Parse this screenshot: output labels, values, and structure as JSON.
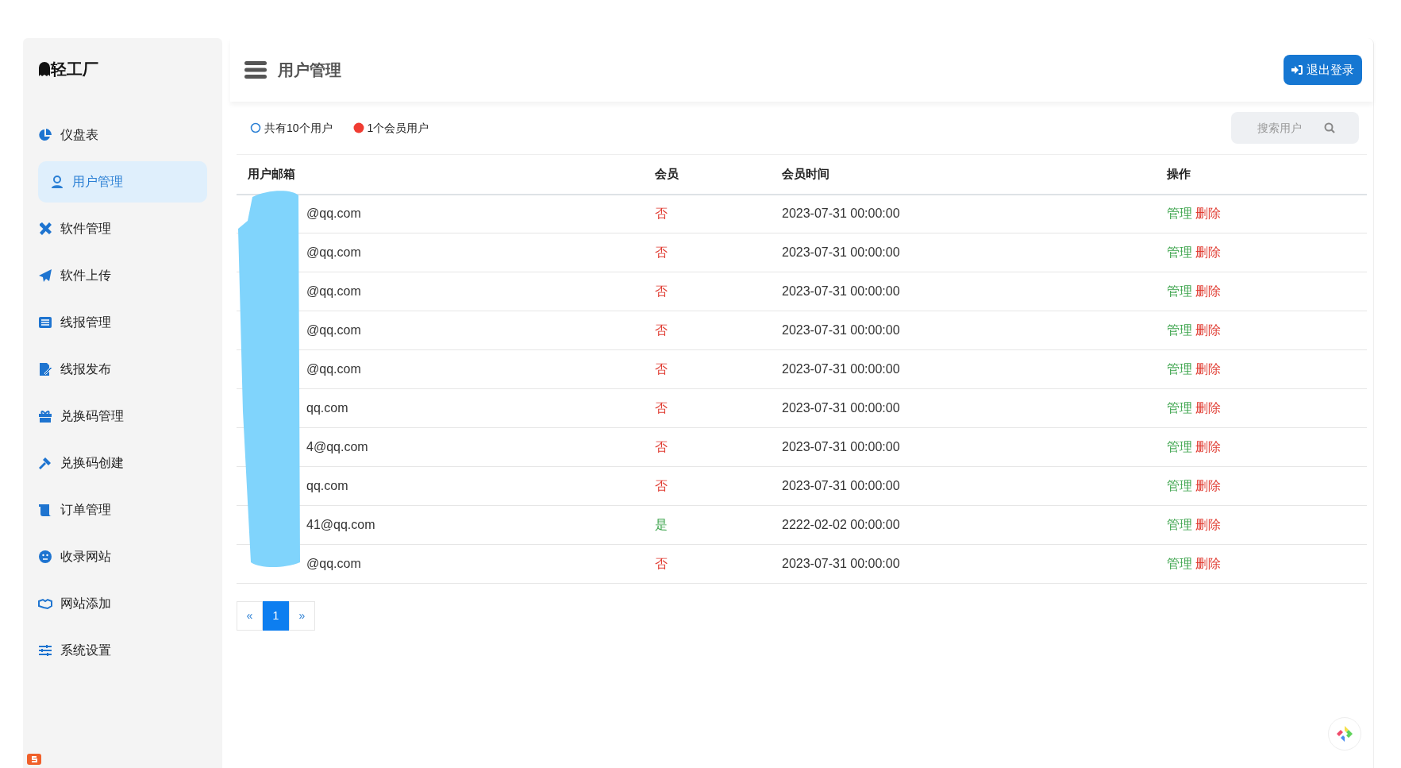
{
  "sidebar": {
    "brand": "轻工厂",
    "items": [
      {
        "label": "仪盘表",
        "selected": false
      },
      {
        "label": "用户管理",
        "selected": true
      },
      {
        "label": "软件管理",
        "selected": false
      },
      {
        "label": "软件上传",
        "selected": false
      },
      {
        "label": "线报管理",
        "selected": false
      },
      {
        "label": "线报发布",
        "selected": false
      },
      {
        "label": "兑换码管理",
        "selected": false
      },
      {
        "label": "兑换码创建",
        "selected": false
      },
      {
        "label": "订单管理",
        "selected": false
      },
      {
        "label": "收录网站",
        "selected": false
      },
      {
        "label": "网站添加",
        "selected": false
      },
      {
        "label": "系统设置",
        "selected": false
      }
    ]
  },
  "header": {
    "title": "用户管理",
    "logout_button": "退出登录"
  },
  "summary": [
    {
      "text": "共有10个用户",
      "color": "#2a7fd4",
      "kind": "ring"
    },
    {
      "text": "1个会员用户",
      "color": "#f03c32",
      "kind": "dot"
    }
  ],
  "search": {
    "placeholder": "搜索用户"
  },
  "table": {
    "columns": [
      "用户邮箱",
      "会员",
      "会员时间",
      "操作"
    ],
    "rows": [
      {
        "email": "@qq.com",
        "member": false,
        "member_label": "否",
        "time": "2023-07-31 00:00:00",
        "actions": [
          "管理",
          "删除"
        ]
      },
      {
        "email": "@qq.com",
        "member": false,
        "member_label": "否",
        "time": "2023-07-31 00:00:00",
        "actions": [
          "管理",
          "删除"
        ]
      },
      {
        "email": "@qq.com",
        "member": false,
        "member_label": "否",
        "time": "2023-07-31 00:00:00",
        "actions": [
          "管理",
          "删除"
        ]
      },
      {
        "email": "@qq.com",
        "member": false,
        "member_label": "否",
        "time": "2023-07-31 00:00:00",
        "actions": [
          "管理",
          "删除"
        ]
      },
      {
        "email": "@qq.com",
        "member": false,
        "member_label": "否",
        "time": "2023-07-31 00:00:00",
        "actions": [
          "管理",
          "删除"
        ]
      },
      {
        "email": "qq.com",
        "member": false,
        "member_label": "否",
        "time": "2023-07-31 00:00:00",
        "actions": [
          "管理",
          "删除"
        ]
      },
      {
        "email": "4@qq.com",
        "member": false,
        "member_label": "否",
        "time": "2023-07-31 00:00:00",
        "actions": [
          "管理",
          "删除"
        ]
      },
      {
        "email": "qq.com",
        "member": false,
        "member_label": "否",
        "time": "2023-07-31 00:00:00",
        "actions": [
          "管理",
          "删除"
        ]
      },
      {
        "email": "41@qq.com",
        "member": true,
        "member_label": "是",
        "time": "2222-02-02 00:00:00",
        "actions": [
          "管理",
          "删除"
        ]
      },
      {
        "email": "@qq.com",
        "member": false,
        "member_label": "否",
        "time": "2023-07-31 00:00:00",
        "actions": [
          "管理",
          "删除"
        ]
      }
    ]
  },
  "pagination": [
    {
      "label": "«",
      "selected": false
    },
    {
      "label": "1",
      "selected": true
    },
    {
      "label": "»",
      "selected": false
    }
  ]
}
